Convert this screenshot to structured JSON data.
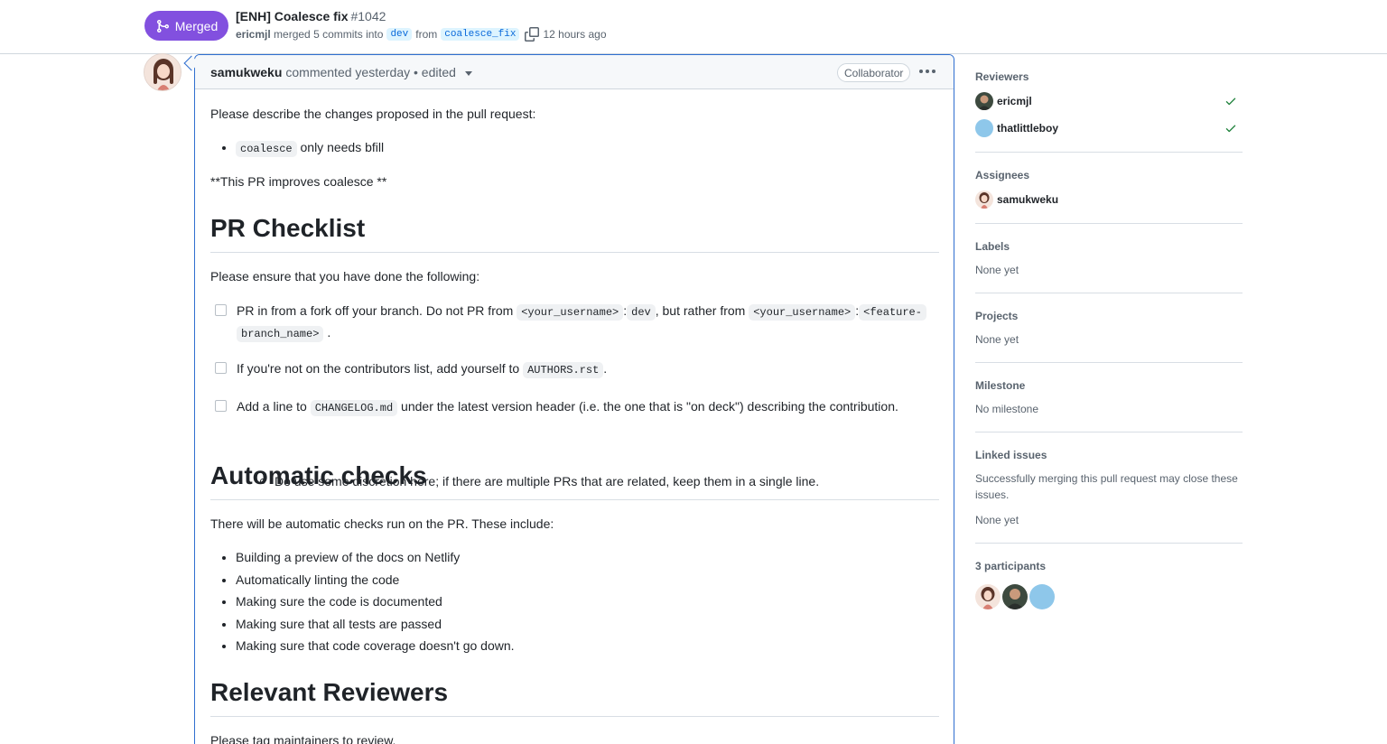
{
  "header": {
    "state_label": "Merged",
    "title": "[ENH] Coalesce fix",
    "number": "#1042",
    "meta": {
      "author": "ericmjl",
      "merged_text": "merged 5 commits into",
      "base_branch": "dev",
      "from_text": "from",
      "head_branch": "coalesce_fix",
      "time_ago": "12 hours ago"
    }
  },
  "comment": {
    "author": "samukweku",
    "action": "commented yesterday",
    "edited": "• edited",
    "role": "Collaborator",
    "body": {
      "intro": "Please describe the changes proposed in the pull request:",
      "bullet_code": "coalesce",
      "bullet_text": "only needs bfill",
      "improves": "**This PR improves coalesce **",
      "h_checklist": "PR Checklist",
      "ensure": "Please ensure that you have done the following:",
      "task1": {
        "t1": "PR in from a fork off your branch. Do not PR from",
        "c1": "<your_username>",
        "colon1": ":",
        "c2": "dev",
        "t2": ", but rather from",
        "c3": "<your_username>",
        "colon2": ":",
        "c4": "<feature-",
        "c5": "branch_name>",
        "t3": "."
      },
      "task2": {
        "t1": "If you're not on the contributors list, add yourself to",
        "c1": "AUTHORS.rst",
        "t2": "."
      },
      "task3": {
        "t1": "Add a line to",
        "c1": "CHANGELOG.md",
        "t2": "under the latest version header (i.e. the one that is \"on deck\") describing the contribution."
      },
      "task3_sub": "Do use some discretion here; if there are multiple PRs that are related, keep them in a single line.",
      "h_checks": "Automatic checks",
      "checks_intro": "There will be automatic checks run on the PR. These include:",
      "checks": [
        "Building a preview of the docs on Netlify",
        "Automatically linting the code",
        "Making sure the code is documented",
        "Making sure that all tests are passed",
        "Making sure that code coverage doesn't go down."
      ],
      "h_reviewers": "Relevant Reviewers",
      "reviewers_intro": "Please tag maintainers to review."
    }
  },
  "sidebar": {
    "reviewers": {
      "title": "Reviewers",
      "people": [
        {
          "name": "ericmjl",
          "status": "approved"
        },
        {
          "name": "thatlittleboy",
          "status": "approved"
        }
      ]
    },
    "assignees": {
      "title": "Assignees",
      "people": [
        {
          "name": "samukweku"
        }
      ]
    },
    "labels": {
      "title": "Labels",
      "value": "None yet"
    },
    "projects": {
      "title": "Projects",
      "value": "None yet"
    },
    "milestone": {
      "title": "Milestone",
      "value": "No milestone"
    },
    "linked_issues": {
      "title": "Linked issues",
      "description": "Successfully merging this pull request may close these issues.",
      "value": "None yet"
    },
    "participants": {
      "title": "3 participants"
    }
  },
  "colors": {
    "merged": "#8250df",
    "focus_border": "#2f6fd0",
    "check": "#1a7f37",
    "link": "#0969da"
  }
}
